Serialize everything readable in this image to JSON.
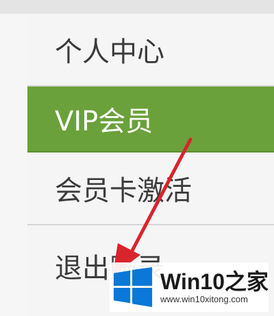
{
  "menu": {
    "items": [
      {
        "label": "个人中心",
        "active": false
      },
      {
        "label": "VIP会员",
        "active": true
      },
      {
        "label": "会员卡激活",
        "active": false
      },
      {
        "label": "退出账录",
        "active": false
      }
    ]
  },
  "colors": {
    "active_bg": "#6aa13a",
    "item_bg": "#f5f5f5",
    "arrow": "#d9242b",
    "logo_blue": "#0a78d7"
  },
  "watermark": {
    "title": "Win10之家",
    "url": "www.win10xitong.com",
    "icon": "windows-logo-icon"
  },
  "annotation": {
    "icon": "red-arrow-icon"
  }
}
